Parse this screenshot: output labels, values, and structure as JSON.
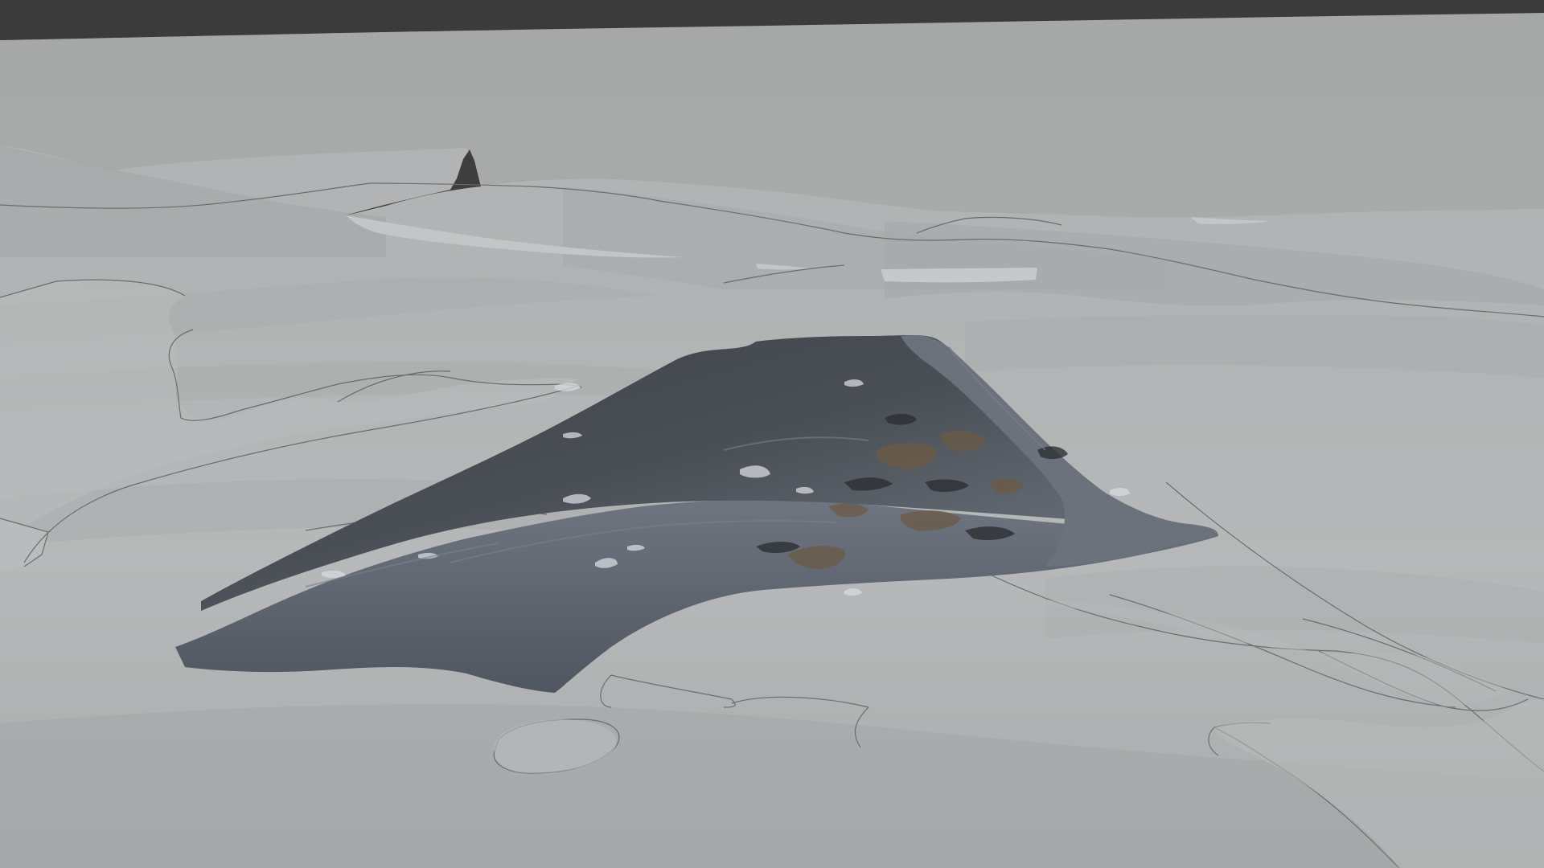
{
  "app": {
    "title": ""
  },
  "viewport": {
    "shading": "solid",
    "scene": "terrain-with-textured-rock",
    "colors": {
      "sky": "#a8aaaa",
      "terrain": "#b3b5b6",
      "terrain_shadow": "#8e9192",
      "contour": "#6a6c6d",
      "water": "#c4c6c7",
      "rock_dark": "#3c4045",
      "rock_mid": "#555b63",
      "rock_light": "#8a9099",
      "rock_brown": "#6b5a45",
      "top_bar": "#3b3b3b"
    }
  }
}
